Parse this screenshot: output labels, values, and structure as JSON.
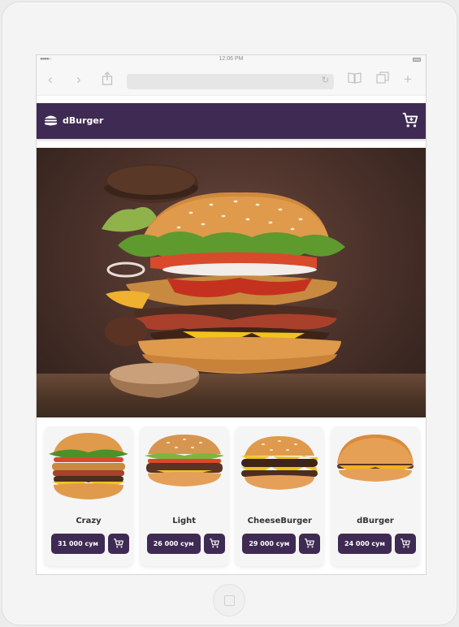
{
  "statusbar": {
    "time": "12:06 PM"
  },
  "browser": {
    "icons": [
      "back-icon",
      "forward-icon",
      "share-icon",
      "reload-icon",
      "bookmarks-icon",
      "tabs-icon",
      "new-tab-icon"
    ]
  },
  "navbar": {
    "brand": "dBurger",
    "icons": [
      "burger-logo-icon",
      "cart-icon"
    ]
  },
  "colors": {
    "brand": "#3f2a53",
    "card_bg": "#f5f5f5"
  },
  "products": [
    {
      "name": "Crazy",
      "price": "31 000 сум"
    },
    {
      "name": "Light",
      "price": "26 000 сум"
    },
    {
      "name": "CheeseBurger",
      "price": "29 000 сум"
    },
    {
      "name": "dBurger",
      "price": "24 000 сум"
    }
  ]
}
